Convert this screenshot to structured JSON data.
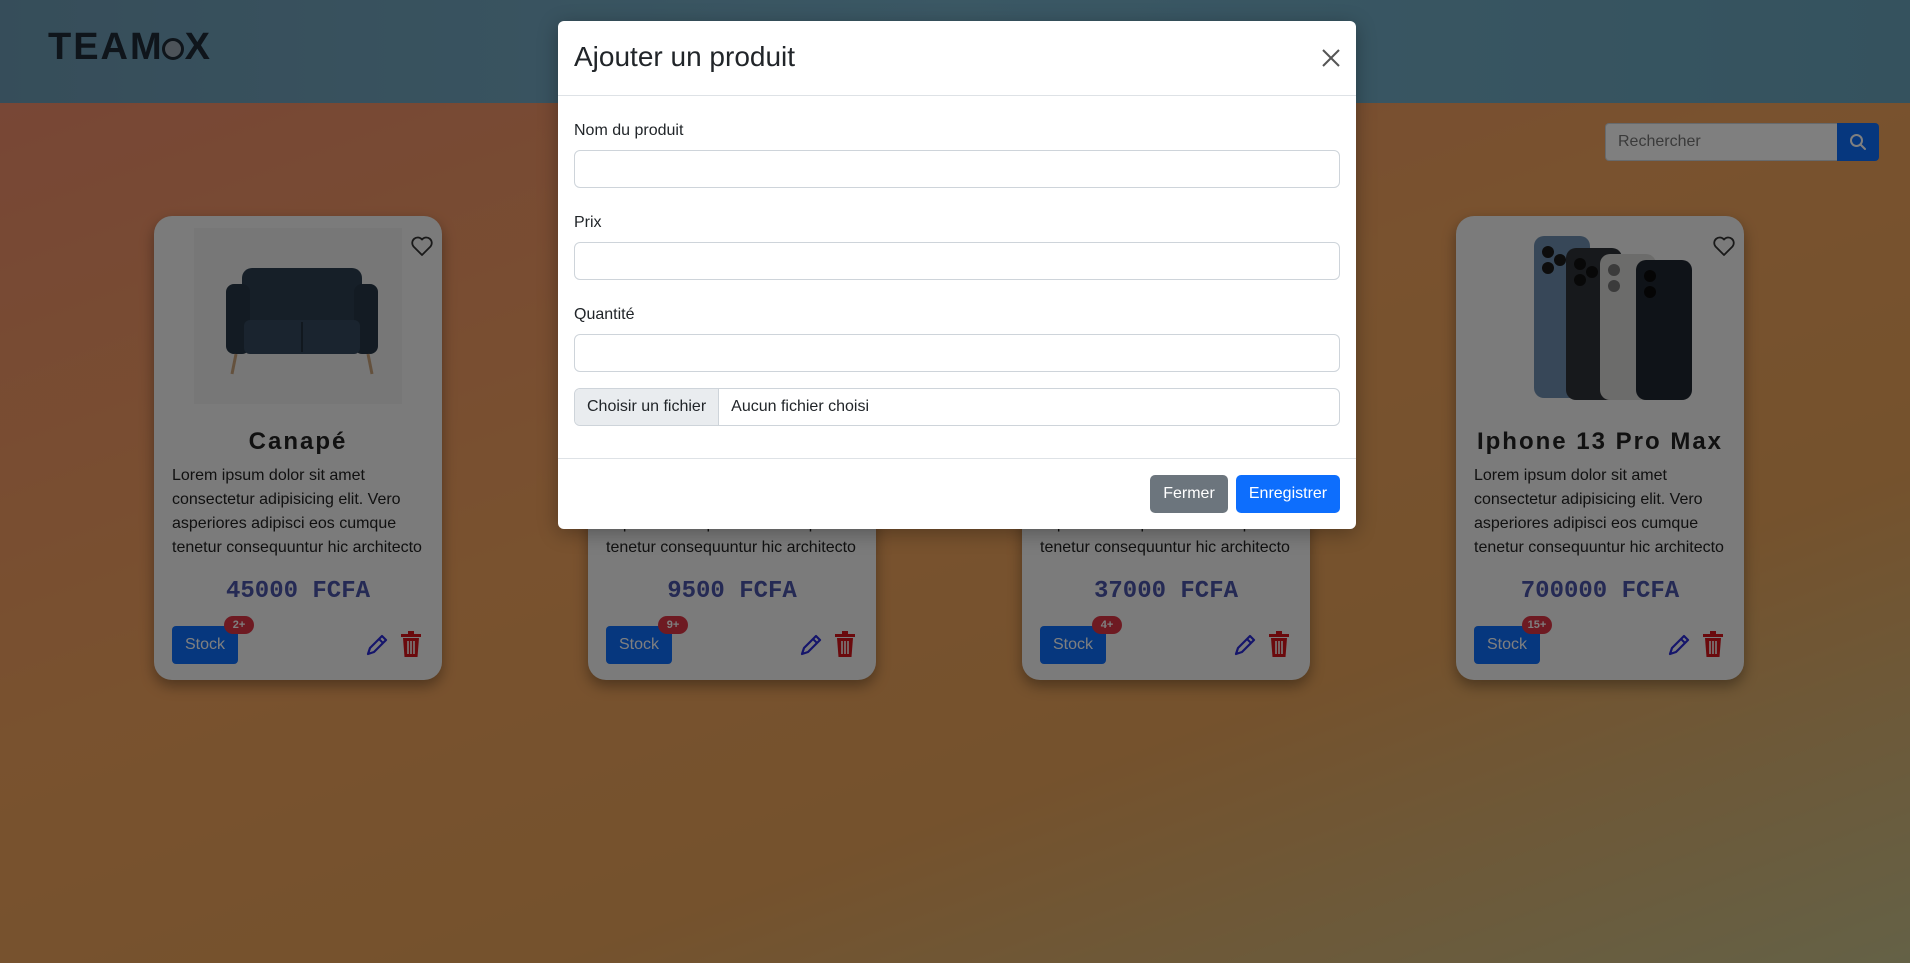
{
  "header": {
    "logo_left": "TEAM",
    "logo_right": "X"
  },
  "search": {
    "placeholder": "Rechercher"
  },
  "products": [
    {
      "title": "Canapé",
      "desc": "Lorem ipsum dolor sit amet consectetur adipisicing elit. Vero asperiores adipisci eos cumque tenetur consequuntur hic architecto",
      "price": "45000 FCFA",
      "stock_label": "Stock",
      "badge": "2+"
    },
    {
      "title": "",
      "desc": "Lorem ipsum dolor sit amet consectetur adipisicing elit. Vero asperiores adipisci eos cumque tenetur consequuntur hic architecto",
      "price": "9500 FCFA",
      "stock_label": "Stock",
      "badge": "9+"
    },
    {
      "title": "",
      "desc": "Lorem ipsum dolor sit amet consectetur adipisicing elit. Vero asperiores adipisci eos cumque tenetur consequuntur hic architecto",
      "price": "37000 FCFA",
      "stock_label": "Stock",
      "badge": "4+"
    },
    {
      "title": "Iphone 13 Pro Max",
      "desc": "Lorem ipsum dolor sit amet consectetur adipisicing elit. Vero asperiores adipisci eos cumque tenetur consequuntur hic architecto",
      "price": "700000 FCFA",
      "stock_label": "Stock",
      "badge": "15+"
    }
  ],
  "modal": {
    "title": "Ajouter un produit",
    "fields": [
      {
        "label": "Nom du produit",
        "value": ""
      },
      {
        "label": "Prix",
        "value": ""
      },
      {
        "label": "Quantité",
        "value": ""
      }
    ],
    "file_button": "Choisir un fichier",
    "file_status": "Aucun fichier choisi",
    "close_label": "Fermer",
    "save_label": "Enregistrer"
  },
  "colors": {
    "primary": "#0d6efd",
    "secondary": "#6c757d",
    "danger": "#dc3545",
    "price": "#4a54a8"
  },
  "icons": [
    "search-icon",
    "heart-icon",
    "pencil-icon",
    "trash-icon",
    "close-icon",
    "sofa-image",
    "iphone-image"
  ]
}
